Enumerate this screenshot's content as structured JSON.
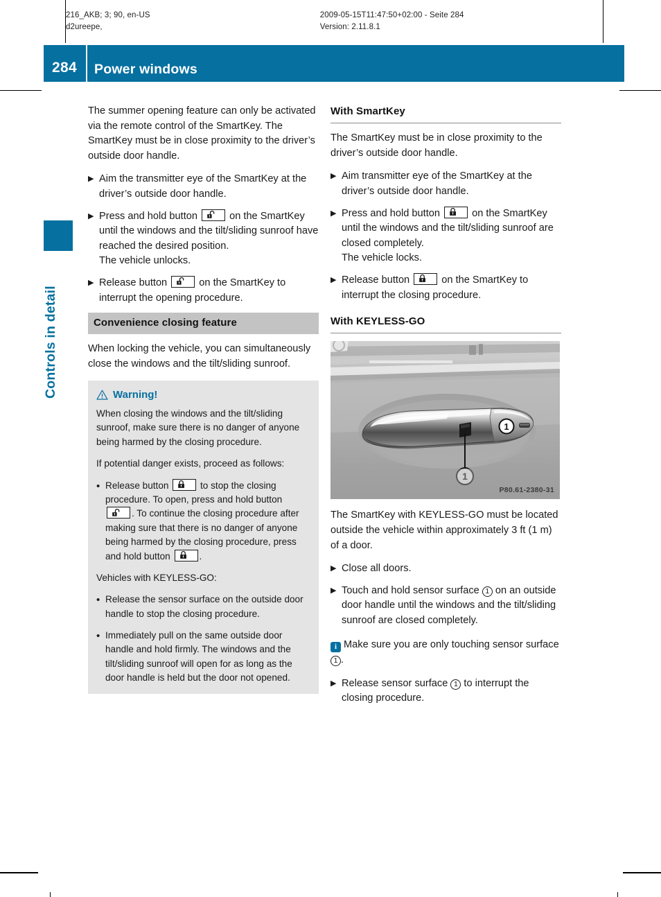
{
  "print_meta": {
    "left_line1": "216_AKB; 3; 90, en-US",
    "left_line2": "d2ureepe,",
    "right_line1": "2009-05-15T11:47:50+02:00 - Seite 284",
    "right_line2": "Version: 2.11.8.1"
  },
  "header": {
    "page_number": "284",
    "title": "Power windows",
    "band_color": "#0670a0"
  },
  "chapter_tab": {
    "label": "Controls in detail",
    "color": "#0670a0"
  },
  "left_column": {
    "intro": "The summer opening feature can only be activated via the remote control of the SmartKey. The SmartKey must be in close proximity to the driver’s outside door handle.",
    "steps": [
      {
        "parts": [
          {
            "type": "text",
            "value": "Aim the transmitter eye of the SmartKey at the driver’s outside door handle."
          }
        ]
      },
      {
        "parts": [
          {
            "type": "text",
            "value": "Press and hold button "
          },
          {
            "type": "icon",
            "value": "unlock-padlock-icon"
          },
          {
            "type": "text",
            "value": " on the SmartKey until the windows and the tilt/sliding sunroof have reached the desired position."
          },
          {
            "type": "break",
            "value": ""
          },
          {
            "type": "text",
            "value": "The vehicle unlocks."
          }
        ]
      },
      {
        "parts": [
          {
            "type": "text",
            "value": "Release button "
          },
          {
            "type": "icon",
            "value": "unlock-padlock-icon"
          },
          {
            "type": "text",
            "value": " on the SmartKey to interrupt the opening procedure."
          }
        ]
      }
    ],
    "section_heading": "Convenience closing feature",
    "section_intro": "When locking the vehicle, you can simultaneously close the windows and the tilt/sliding sunroof.",
    "warning": {
      "title": "Warning!",
      "body": "When closing the windows and the tilt/sliding sunroof, make sure there is no danger of anyone being harmed by the closing procedure.",
      "lead_in": "If potential danger exists, proceed as follows:",
      "bullet1_part1": "Release button ",
      "bullet1_part2": " to stop the closing procedure. To open, press and hold button ",
      "bullet1_part3": ". To continue the closing procedure after making sure that there is no danger of anyone being harmed by the closing procedure, press and hold button ",
      "bullet1_part4": ".",
      "keyless_lead_in": "Vehicles with KEYLESS-GO:",
      "bullet2": "Release the sensor surface on the outside door handle to stop the closing procedure.",
      "bullet3": "Immediately pull on the same outside door handle and hold firmly. The windows and the tilt/sliding sunroof will open for as long as the door handle is held but the door not opened."
    }
  },
  "right_column": {
    "smartkey_heading": "With SmartKey",
    "smartkey_intro": "The SmartKey must be in close proximity to the driver’s outside door handle.",
    "smartkey_steps": [
      {
        "parts": [
          {
            "type": "text",
            "value": "Aim transmitter eye of the SmartKey at the driver’s outside door handle."
          }
        ]
      },
      {
        "parts": [
          {
            "type": "text",
            "value": "Press and hold button "
          },
          {
            "type": "icon",
            "value": "lock-padlock-icon"
          },
          {
            "type": "text",
            "value": " on the SmartKey until the windows and the tilt/sliding sunroof are closed completely."
          },
          {
            "type": "break",
            "value": ""
          },
          {
            "type": "text",
            "value": "The vehicle locks."
          }
        ]
      },
      {
        "parts": [
          {
            "type": "text",
            "value": "Release button "
          },
          {
            "type": "icon",
            "value": "lock-padlock-icon"
          },
          {
            "type": "text",
            "value": " on the SmartKey to interrupt the closing procedure."
          }
        ]
      }
    ],
    "keylessgo_heading": "With KEYLESS-GO",
    "figure": {
      "alt": "Outside door handle with KEYLESS-GO sensor surface",
      "code": "P80.61-2380-31",
      "callout": "1"
    },
    "keylessgo_intro": "The SmartKey with KEYLESS-GO must be located outside the vehicle within approximately 3 ft (1 m) of a door.",
    "keylessgo_step1": "Close all doors.",
    "keylessgo_step2_a": "Touch and hold sensor surface ",
    "keylessgo_step2_b": " on an outside door handle until the windows and the tilt/sliding sunroof are closed completely.",
    "note_a": "Make sure you are only touching sensor surface ",
    "note_b": ".",
    "keylessgo_step3_a": "Release sensor surface ",
    "keylessgo_step3_b": " to interrupt the closing procedure."
  },
  "glyphs": {
    "triangle_bullet": "▶",
    "dot_bullet": "•",
    "info_letter": "i"
  }
}
